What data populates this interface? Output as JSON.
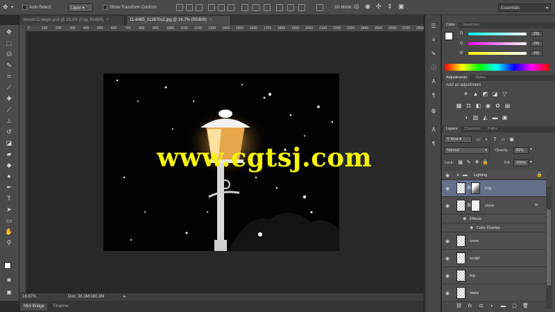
{
  "options_bar": {
    "auto_select_label": "Auto-Select:",
    "auto_select_value": "Layer",
    "show_transform_label": "Show Transform Controls",
    "mode_3d_label": "3D Mode:",
    "workspace_value": "Essentials"
  },
  "tabs": [
    {
      "label": "lesson11-begin.psd @ 33.3% (Fog, RGB/8)",
      "close": "×"
    },
    {
      "label": "11-8485_113870s2.jpg @ 16.7% (RGB/8)",
      "close": "×"
    }
  ],
  "ruler_ticks": [
    "0",
    "100",
    "200",
    "300",
    "400",
    "500",
    "600",
    "700",
    "800",
    "900",
    "1000",
    "1100",
    "1200",
    "1300",
    "1400",
    "1500",
    "1600",
    "1700",
    "1800",
    "1900",
    "2000",
    "2100",
    "2200",
    "2300",
    "2400",
    "2500",
    "2600",
    "2700",
    "2800"
  ],
  "status": {
    "zoom": "16.67%",
    "doc": "Doc: 36.3M/180.3M"
  },
  "bottom_tabs": [
    "Mini Bridge",
    "Timeline"
  ],
  "watermark": "www.cgtsj.com",
  "color_panel": {
    "tabs": [
      "Color",
      "Swatches"
    ],
    "channels": [
      {
        "label": "R",
        "value": "255",
        "color": "#ff0000"
      },
      {
        "label": "G",
        "value": "255",
        "color": "#00ff00"
      },
      {
        "label": "B",
        "value": "255",
        "color": "#0000ff"
      }
    ]
  },
  "adjustments_panel": {
    "tabs": [
      "Adjustments",
      "Styles"
    ],
    "title": "Add an adjustment"
  },
  "layers_panel": {
    "tabs": [
      "Layers",
      "Channels",
      "Paths"
    ],
    "filter_kind": "Kind",
    "blend_mode": "Normal",
    "opacity_label": "Opacity:",
    "opacity_value": "82%",
    "lock_label": "Lock:",
    "fill_label": "Fill:",
    "fill_value": "100%",
    "layers": [
      {
        "name": "Lighting",
        "type": "group"
      },
      {
        "name": "Fog",
        "type": "layer",
        "selected": true
      },
      {
        "name": "snow",
        "type": "layer",
        "fx": "fx"
      },
      {
        "name": "Effects",
        "type": "effects"
      },
      {
        "name": "Color Overlay",
        "type": "effect"
      },
      {
        "name": "snow",
        "type": "layer"
      },
      {
        "name": "sculpt",
        "type": "layer"
      },
      {
        "name": "fog",
        "type": "layer"
      },
      {
        "name": "stairs",
        "type": "layer"
      }
    ]
  }
}
